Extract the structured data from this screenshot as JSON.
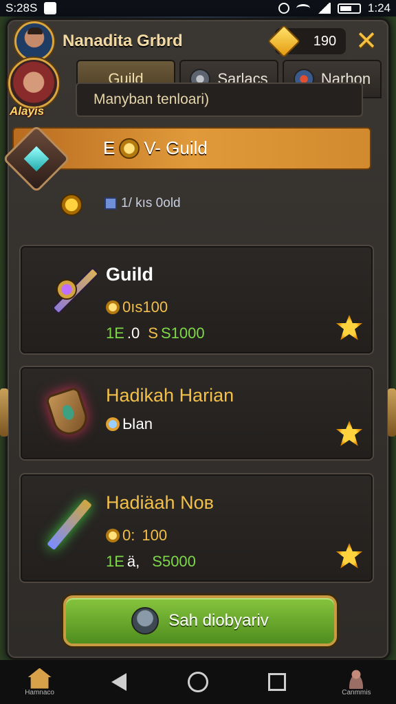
{
  "status_bar": {
    "time_left": "S:28S",
    "time_right": "1:24"
  },
  "header": {
    "title": "Nanadita Grbrd",
    "currency_value": "190",
    "close_label": "✕"
  },
  "tabs": [
    {
      "label": "Guild",
      "active": true
    },
    {
      "label": "Sarlacs",
      "icon": "helmet-icon"
    },
    {
      "label": "Narhon",
      "icon": "shield-icon"
    }
  ],
  "profile": {
    "name": "Alayis"
  },
  "info_text": "Manyban tenloari)",
  "guild_banner": {
    "title_prefix": "E",
    "title_main": "V- Guild",
    "sub_text": "1/ kıs 0old"
  },
  "cards": [
    {
      "title": "Guild",
      "title_color": "#ffffff",
      "line1": "0ıs100",
      "line2_green": "1E",
      "line2_white": ".0",
      "line2_yellow": "S",
      "line2_green2": "S1000"
    },
    {
      "title": "Hadikah Harian",
      "title_color": "#f2c04a",
      "line1": "Ыan"
    },
    {
      "title": "Hadiäah Noв",
      "title_color": "#f2c04a",
      "line1": "0:",
      "line1_b": "100",
      "line2_green": "1Е",
      "line2_white": "ä,",
      "line2_green2": "S5000"
    }
  ],
  "action_button": {
    "label": "Sah diobyariv"
  },
  "navbar": {
    "home_label": "Hamnaco",
    "profile_label": "Canmmis"
  },
  "colors": {
    "accent_gold": "#d9a640",
    "banner_orange": "#e09a3a",
    "button_green": "#6aa82e",
    "value_green": "#7fd84a"
  }
}
